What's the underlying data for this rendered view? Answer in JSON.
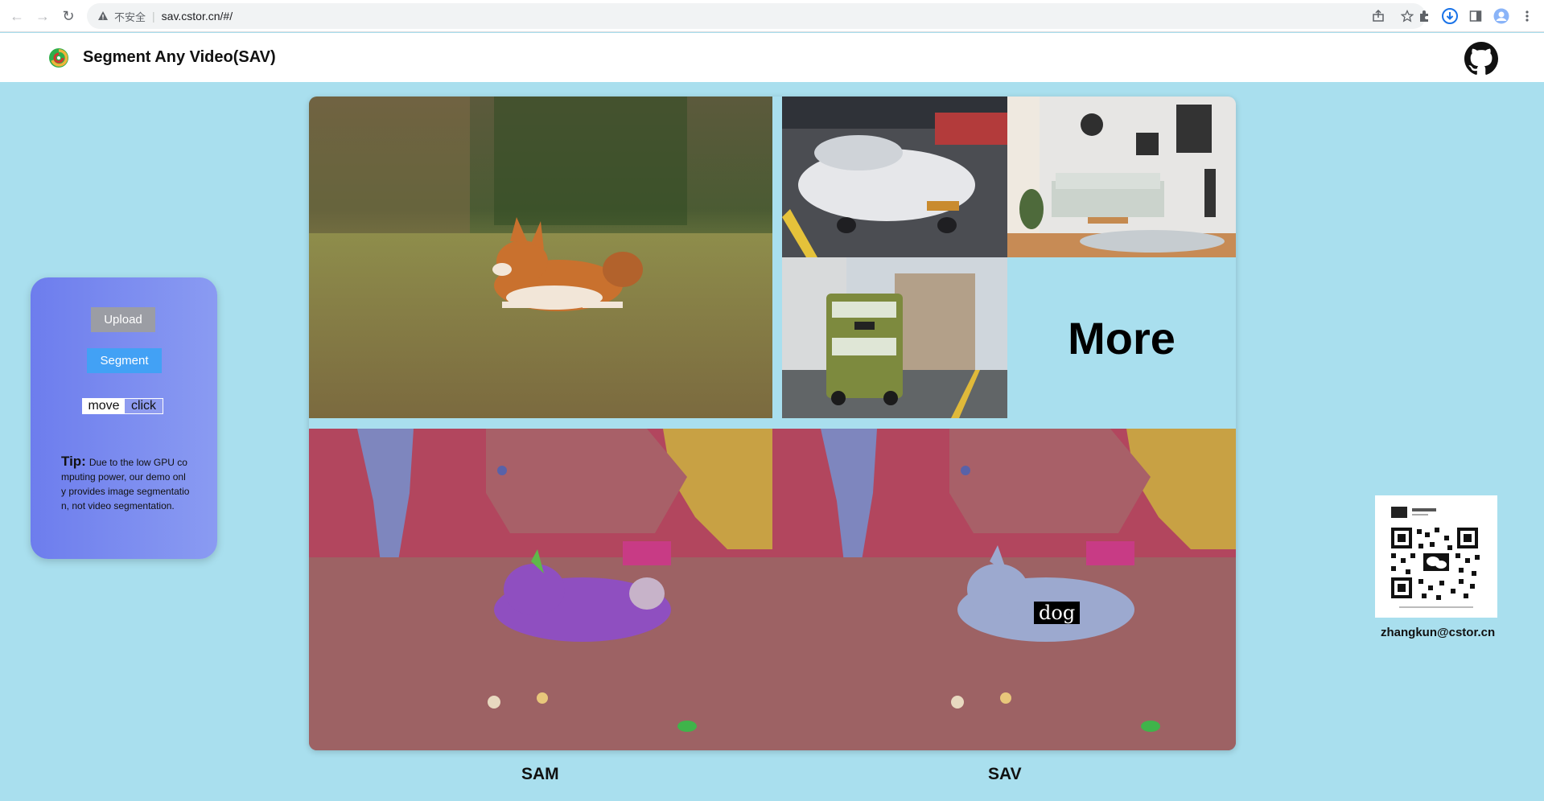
{
  "browser": {
    "url_security": "不安全",
    "url": "sav.cstor.cn/#/"
  },
  "header": {
    "title": "Segment Any Video(SAV)"
  },
  "panel": {
    "upload_label": "Upload",
    "segment_label": "Segment",
    "mode_move": "move",
    "mode_click": "click",
    "tip_label": "Tip:",
    "tip_text": "Due to the low GPU computing power, our demo only provides image segmentation, not video segmentation."
  },
  "gallery": {
    "more_label": "More"
  },
  "results": {
    "left_caption": "SAM",
    "right_caption": "SAV",
    "object_label": "dog"
  },
  "contact": {
    "email": "zhangkun@cstor.cn"
  },
  "colors": {
    "page_bg": "#a9dfee",
    "panel_gradient_start": "#6d7ded",
    "panel_gradient_end": "#8a9bf2",
    "upload_button": "#9b9da4",
    "segment_button": "#42a1f5"
  }
}
